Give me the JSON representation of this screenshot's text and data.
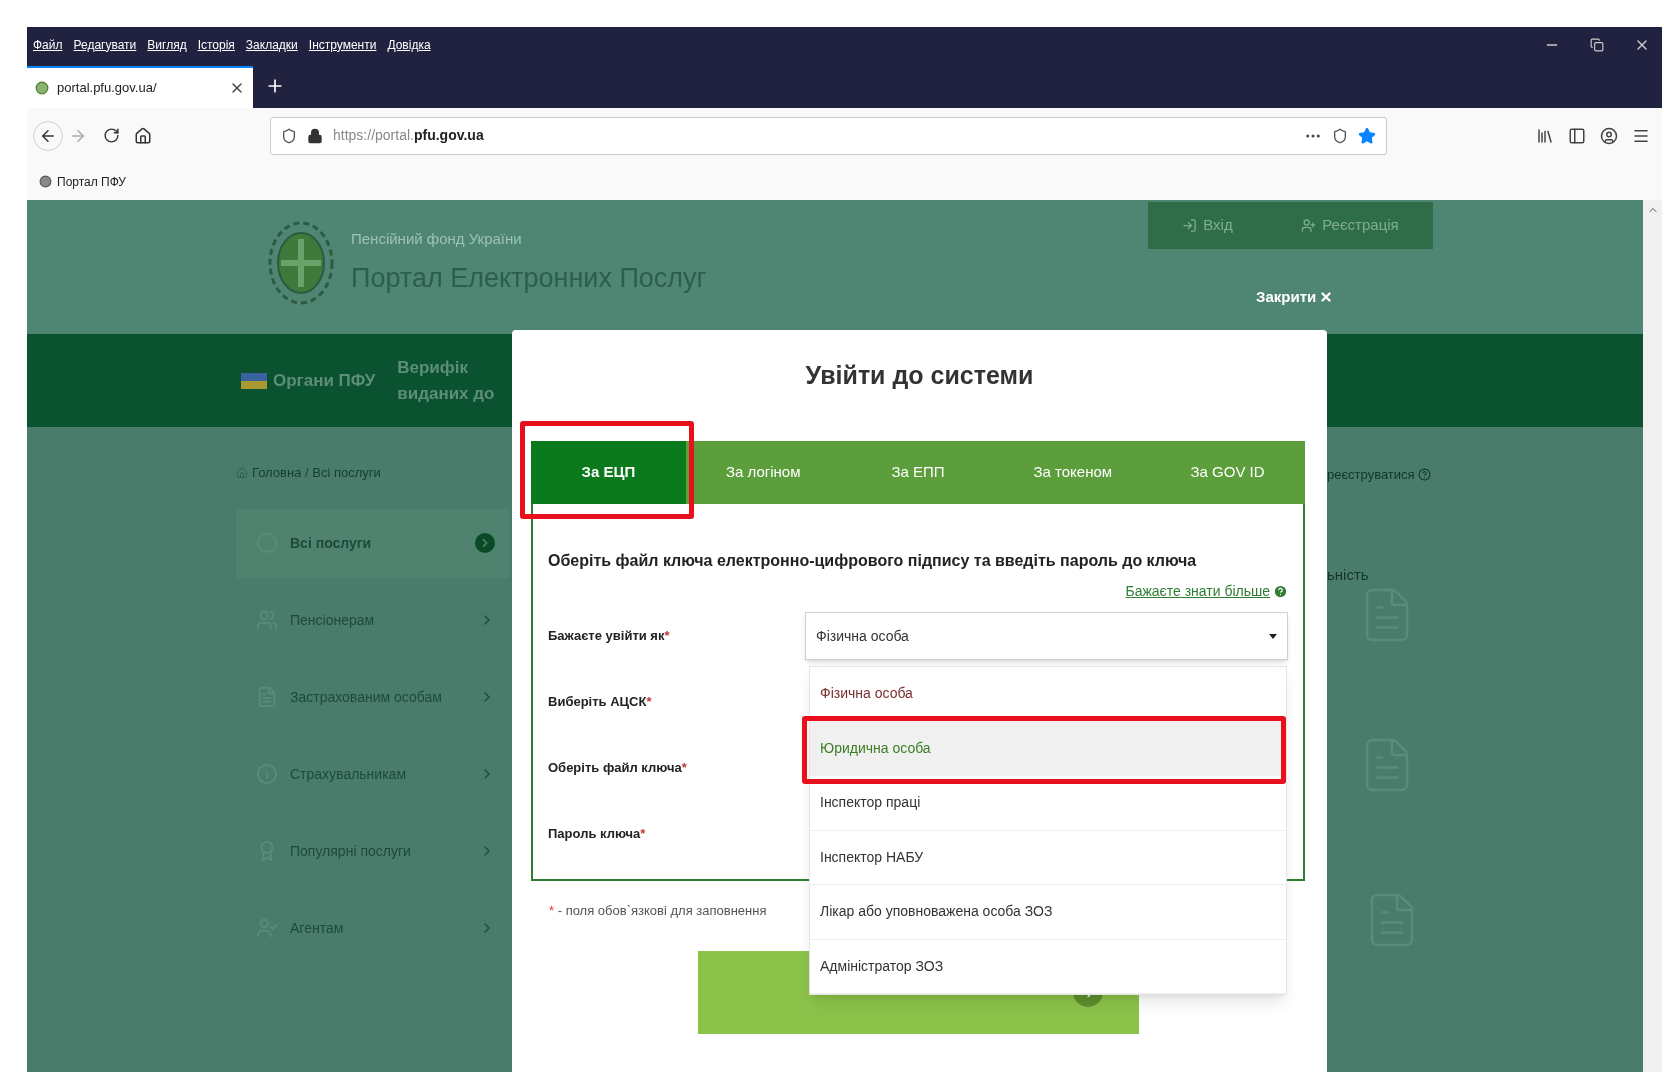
{
  "browser": {
    "menu": [
      "Файл",
      "Редагувати",
      "Вигляд",
      "Історія",
      "Закладки",
      "Інструменти",
      "Довідка"
    ],
    "tab": {
      "title": "portal.pfu.gov.ua/",
      "selected": true
    },
    "address_bar": {
      "url": "https://portal.**pfu.gov.ua**"
    },
    "bookmarks": [
      {
        "label": "Портал ПФУ"
      }
    ]
  },
  "page": {
    "header": {
      "subtitle": "Пенсійний фонд України",
      "title": "Портал Електронних Послуг",
      "actions": [
        "Вхід",
        "Реєстрація"
      ]
    },
    "nav": [
      {
        "lines": [
          "Органи ПФУ"
        ]
      },
      {
        "lines": [
          "Верифік",
          "виданих до"
        ]
      }
    ],
    "breadcrumb": "Головна / Всі послуги",
    "sidebar": {
      "items": [
        {
          "label": "Всі послуги",
          "selected": true
        },
        {
          "label": "Пенсіонерам",
          "selected": false
        },
        {
          "label": "Застрахованим особам",
          "selected": false
        },
        {
          "label": "Страхувальникам",
          "selected": false
        },
        {
          "label": "Популярні послуги",
          "selected": false
        },
        {
          "label": "Агентам",
          "selected": false
        }
      ]
    },
    "right_fragments": [
      "реєструватися",
      "ьність"
    ]
  },
  "close_link": "Закрити",
  "modal": {
    "title": "Увійти до системи",
    "tabs": [
      {
        "label": "За ЕЦП",
        "selected": true,
        "highlighted": true
      },
      {
        "label": "За логіном",
        "selected": false,
        "highlighted": false
      },
      {
        "label": "За ЕПП",
        "selected": false,
        "highlighted": false
      },
      {
        "label": "За токеном",
        "selected": false,
        "highlighted": false
      },
      {
        "label": "За GOV ID",
        "selected": false,
        "highlighted": false
      }
    ],
    "instruction": "Оберіть файл ключа електронно-цифрового підпису та введіть пароль до ключа",
    "help_link": "Бажаєте знати більше",
    "fields": [
      {
        "label": "Бажаєте увійти як",
        "required_mark": "*"
      },
      {
        "label": "Виберіть АЦСК",
        "required_mark": "*"
      },
      {
        "label": "Оберіть файл ключа",
        "required_mark": "*"
      },
      {
        "label": "Пароль ключа",
        "required_mark": "*"
      }
    ],
    "select": {
      "value": "Фізична особа",
      "expanded": true
    },
    "options": [
      {
        "label": "Фізична особа",
        "selected": true,
        "hovered": false,
        "highlighted": false
      },
      {
        "label": "Юридична особа",
        "selected": false,
        "hovered": true,
        "highlighted": true
      },
      {
        "label": "Інспектор праці",
        "selected": false,
        "hovered": false,
        "highlighted": false
      },
      {
        "label": "Інспектор НАБУ",
        "selected": false,
        "hovered": false,
        "highlighted": false
      },
      {
        "label": "Лікар або уповноважена особа ЗОЗ",
        "selected": false,
        "hovered": false,
        "highlighted": false
      },
      {
        "label": "Адміністратор ЗОЗ",
        "selected": false,
        "hovered": false,
        "highlighted": false
      }
    ],
    "footnote": {
      "mark": "*",
      "text": "- поля обов`язкові для заповнення"
    }
  }
}
